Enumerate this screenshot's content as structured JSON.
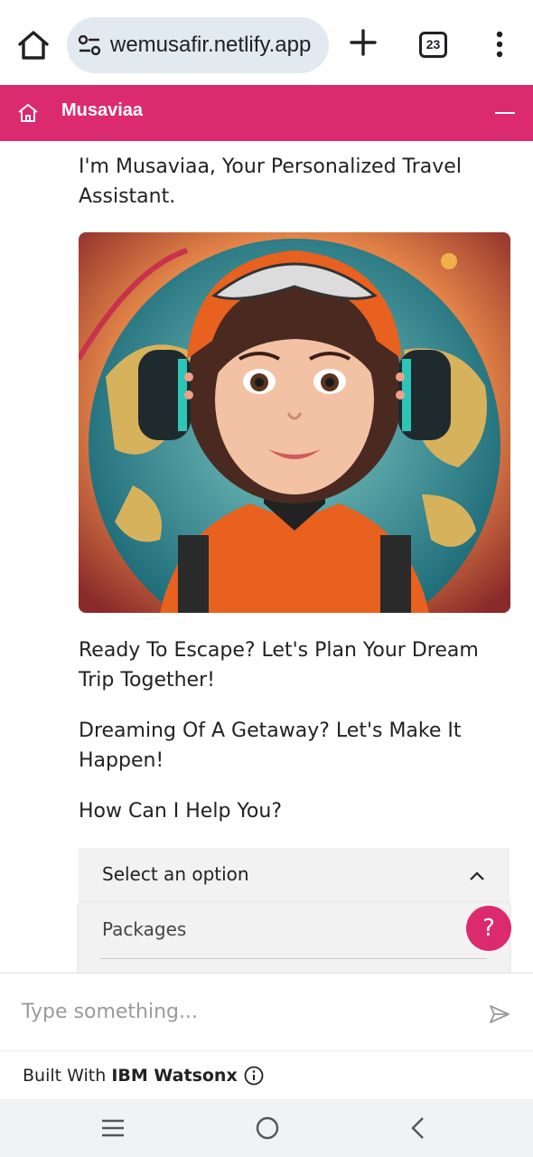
{
  "browser": {
    "url": "wemusafir.netlify.app",
    "tab_count": "23"
  },
  "app": {
    "title": "Musaviaa"
  },
  "chat": {
    "intro": "I'm Musaviaa, Your Personalized Travel Assistant.",
    "line1": "Ready To Escape? Let's Plan Your Dream Trip Together!",
    "line2": "Dreaming Of A Getaway? Let's Make It Happen!",
    "line3": "How Can I Help You?",
    "select_placeholder": "Select an option",
    "options": [
      "Packages"
    ],
    "help_label": "?"
  },
  "input": {
    "placeholder": "Type something..."
  },
  "footer": {
    "built_with": "Built With",
    "brand": "IBM Watsonx"
  },
  "colors": {
    "accent": "#dc2a6e",
    "url_bar": "#e3e9f0",
    "select_bg": "#f2f2f2"
  }
}
